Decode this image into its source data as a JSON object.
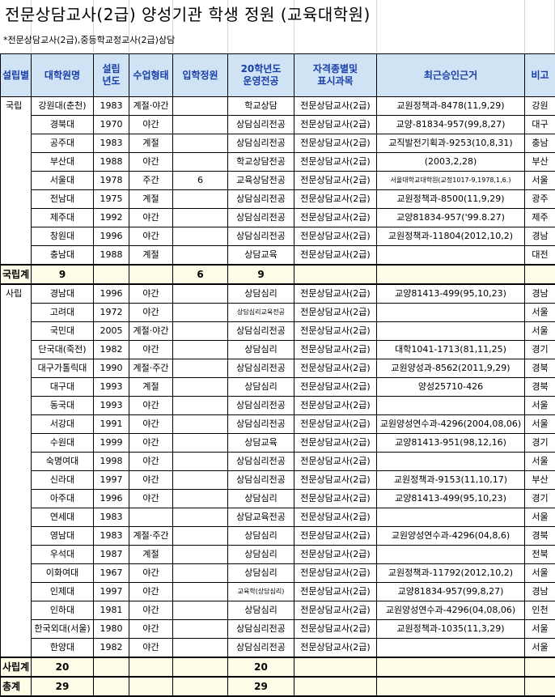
{
  "title": "전문상담교사(2급) 양성기관 학생 정원 (교육대학원)",
  "subtitle": "*전문상담교사(2급),중등학교정교사(2급)상담",
  "headers": [
    "설립별",
    "대학원명",
    "설립\n년도",
    "수업형태",
    "입학정원",
    "20학년도\n운영전공",
    "자격종별및\n표시과목",
    "최근승인근거",
    "비고"
  ],
  "national": {
    "type_label": "국립",
    "rows": [
      {
        "name": "강원대(춘천)",
        "year": "1983",
        "mode": "계절·야간",
        "quota": "",
        "major": "학교상담",
        "cert": "전문상담교사(2급)",
        "approval": "교원정책과-8478(11,9,29)",
        "note": "강원"
      },
      {
        "name": "경북대",
        "year": "1970",
        "mode": "야간",
        "quota": "",
        "major": "상담심리전공",
        "cert": "전문상담교사(2급)",
        "approval": "교양-81834-957(99,8,27)",
        "note": "대구"
      },
      {
        "name": "공주대",
        "year": "1983",
        "mode": "계절",
        "quota": "",
        "major": "상담심리전공",
        "cert": "전문상담교사(2급)",
        "approval": "교직발전기획과-9253(10,8,31)",
        "note": "충남"
      },
      {
        "name": "부산대",
        "year": "1988",
        "mode": "야간",
        "quota": "",
        "major": "학교상담전공",
        "cert": "전문상담교사(2급)",
        "approval": "(2003,2,28)",
        "note": "부산"
      },
      {
        "name": "서울대",
        "year": "1978",
        "mode": "주간",
        "quota": "6",
        "major": "교육상담전공",
        "cert": "전문상담교사(2급)",
        "approval": "서울대학교대학원(교정1017-9,1978,1,6.)",
        "note": "서울"
      },
      {
        "name": "전남대",
        "year": "1975",
        "mode": "계절",
        "quota": "",
        "major": "상담심리전공",
        "cert": "전문상담교사(2급)",
        "approval": "교원정책과-8500(11,9,29)",
        "note": "광주"
      },
      {
        "name": "제주대",
        "year": "1992",
        "mode": "야간",
        "quota": "",
        "major": "상담심리전공",
        "cert": "전문상담교사(2급)",
        "approval": "교양81834-957('99.8.27)",
        "note": "제주"
      },
      {
        "name": "창원대",
        "year": "1996",
        "mode": "야간",
        "quota": "",
        "major": "상담심리전공",
        "cert": "전문상담교사(2급)",
        "approval": "교원정책과-11804(2012,10,2)",
        "note": "경남"
      },
      {
        "name": "충남대",
        "year": "1988",
        "mode": "계절",
        "quota": "",
        "major": "상담교육",
        "cert": "전문상담교사(2급)",
        "approval": "",
        "note": "대전"
      }
    ],
    "total": {
      "label": "국립계",
      "count": "9",
      "quota": "6",
      "majors": "9"
    }
  },
  "private": {
    "type_label": "사립",
    "rows": [
      {
        "name": "경남대",
        "year": "1996",
        "mode": "야간",
        "quota": "",
        "major": "상담심리",
        "cert": "전문상담교사(2급)",
        "approval": "교양81413-499(95,10,23)",
        "note": "경남"
      },
      {
        "name": "고려대",
        "year": "1972",
        "mode": "야간",
        "quota": "",
        "major": "상담심리교육전공",
        "cert": "전문상담교사(2급)",
        "approval": "",
        "note": "서울"
      },
      {
        "name": "국민대",
        "year": "2005",
        "mode": "계절·야간",
        "quota": "",
        "major": "상담심리전공",
        "cert": "전문상담교사(2급)",
        "approval": "",
        "note": "서울"
      },
      {
        "name": "단국대(죽전)",
        "year": "1982",
        "mode": "야간",
        "quota": "",
        "major": "상담심리",
        "cert": "전문상담교사(2급)",
        "approval": "대학1041-1713(81,11,25)",
        "note": "경기"
      },
      {
        "name": "대구가톨릭대",
        "year": "1990",
        "mode": "계절·주간",
        "quota": "",
        "major": "상담심리전공",
        "cert": "전문상담교사(2급)",
        "approval": "교원양성과-8562(2011,9,29)",
        "note": "경북"
      },
      {
        "name": "대구대",
        "year": "1993",
        "mode": "계절",
        "quota": "",
        "major": "상담심리",
        "cert": "전문상담교사(2급)",
        "approval": "양성25710-426",
        "note": "경북"
      },
      {
        "name": "동국대",
        "year": "1993",
        "mode": "야간",
        "quota": "",
        "major": "상담심리전공",
        "cert": "전문상담교사(2급)",
        "approval": "",
        "note": "서울"
      },
      {
        "name": "서강대",
        "year": "1991",
        "mode": "야간",
        "quota": "",
        "major": "상담심리전공",
        "cert": "전문상담교사(2급)",
        "approval": "교원양성연수과-4296(2004,08,06)",
        "note": "서울"
      },
      {
        "name": "수원대",
        "year": "1999",
        "mode": "야간",
        "quota": "",
        "major": "상담교육",
        "cert": "전문상담교사(2급)",
        "approval": "교양81413-951(98,12,16)",
        "note": "경기"
      },
      {
        "name": "숙명여대",
        "year": "1998",
        "mode": "야간",
        "quota": "",
        "major": "상담심리전공",
        "cert": "전문상담교사(2급)",
        "approval": "",
        "note": "서울"
      },
      {
        "name": "신라대",
        "year": "1997",
        "mode": "야간",
        "quota": "",
        "major": "상담심리전공",
        "cert": "전문상담교사(2급)",
        "approval": "교원정책과-9153(11,10,17)",
        "note": "부산"
      },
      {
        "name": "아주대",
        "year": "1996",
        "mode": "야간",
        "quota": "",
        "major": "상담심리",
        "cert": "전문상담교사(2급)",
        "approval": "교양81413-499(95,10,23)",
        "note": "경기"
      },
      {
        "name": "연세대",
        "year": "1983",
        "mode": "",
        "quota": "",
        "major": "상담교육전공",
        "cert": "전문상담교사(2급)",
        "approval": "",
        "note": "서울"
      },
      {
        "name": "영남대",
        "year": "1983",
        "mode": "계절·주간",
        "quota": "",
        "major": "상담심리",
        "cert": "전문상담교사(2급)",
        "approval": "교원양성연수과-4296(04,8,6)",
        "note": "경북"
      },
      {
        "name": "우석대",
        "year": "1987",
        "mode": "계절",
        "quota": "",
        "major": "상담심리",
        "cert": "전문상담교사(2급)",
        "approval": "",
        "note": "전북"
      },
      {
        "name": "이화여대",
        "year": "1967",
        "mode": "야간",
        "quota": "",
        "major": "상담심리",
        "cert": "전문상담교사(2급)",
        "approval": "교원정책과-11792(2012,10,2)",
        "note": "서울"
      },
      {
        "name": "인제대",
        "year": "1997",
        "mode": "야간",
        "quota": "",
        "major": "교육학(상담심리)",
        "cert": "전문상담교사(2급)",
        "approval": "교양81834-957(99,8,27)",
        "note": "경남"
      },
      {
        "name": "인하대",
        "year": "1981",
        "mode": "야간",
        "quota": "",
        "major": "상담심리",
        "cert": "전문상담교사(2급)",
        "approval": "교원양성연수과-4296(04,08,06)",
        "note": "인천"
      },
      {
        "name": "한국외대(서울)",
        "year": "1980",
        "mode": "야간",
        "quota": "",
        "major": "상담심리전공",
        "cert": "전문상담교사(2급)",
        "approval": "교원정책과-1035(11,3,29)",
        "note": "서울"
      },
      {
        "name": "한양대",
        "year": "1982",
        "mode": "야간",
        "quota": "",
        "major": "상담심리전공",
        "cert": "전문상담교사(2급)",
        "approval": "",
        "note": "서울"
      }
    ],
    "total": {
      "label": "사립계",
      "count": "20",
      "quota": "",
      "majors": "20"
    }
  },
  "grand_total": {
    "label": "총계",
    "count": "29",
    "quota": "",
    "majors": "29"
  }
}
